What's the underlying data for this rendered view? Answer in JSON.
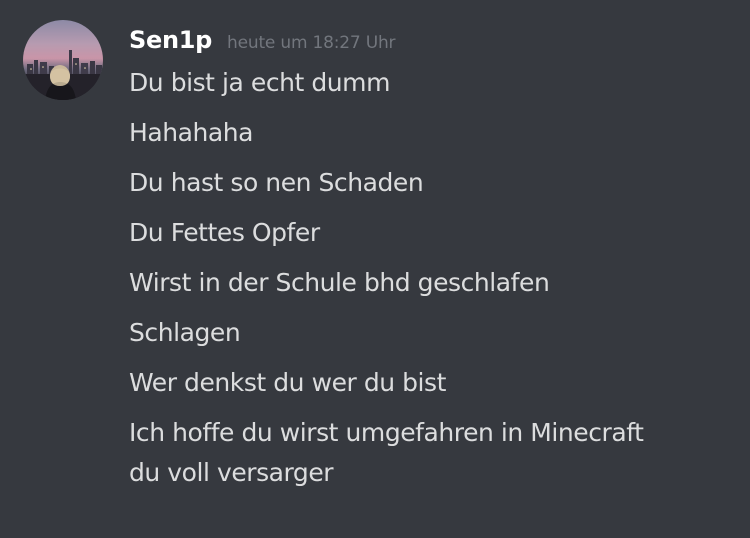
{
  "author": {
    "username": "Sen1p",
    "timestamp": "heute um 18:27 Uhr",
    "avatar_icon": "user-avatar-city-sunset"
  },
  "messages": [
    "Du bist ja echt dumm",
    "Hahahaha",
    "Du hast so nen Schaden",
    "Du Fettes Opfer",
    "Wirst in der Schule bhd geschlafen",
    "Schlagen",
    "Wer denkst du wer du bist",
    "Ich hoffe du wirst umgefahren in Minecraft",
    "du voll versarger"
  ],
  "colors": {
    "background": "#36393f",
    "username": "#ffffff",
    "timestamp": "#72767d",
    "message_text": "#dcddde"
  }
}
